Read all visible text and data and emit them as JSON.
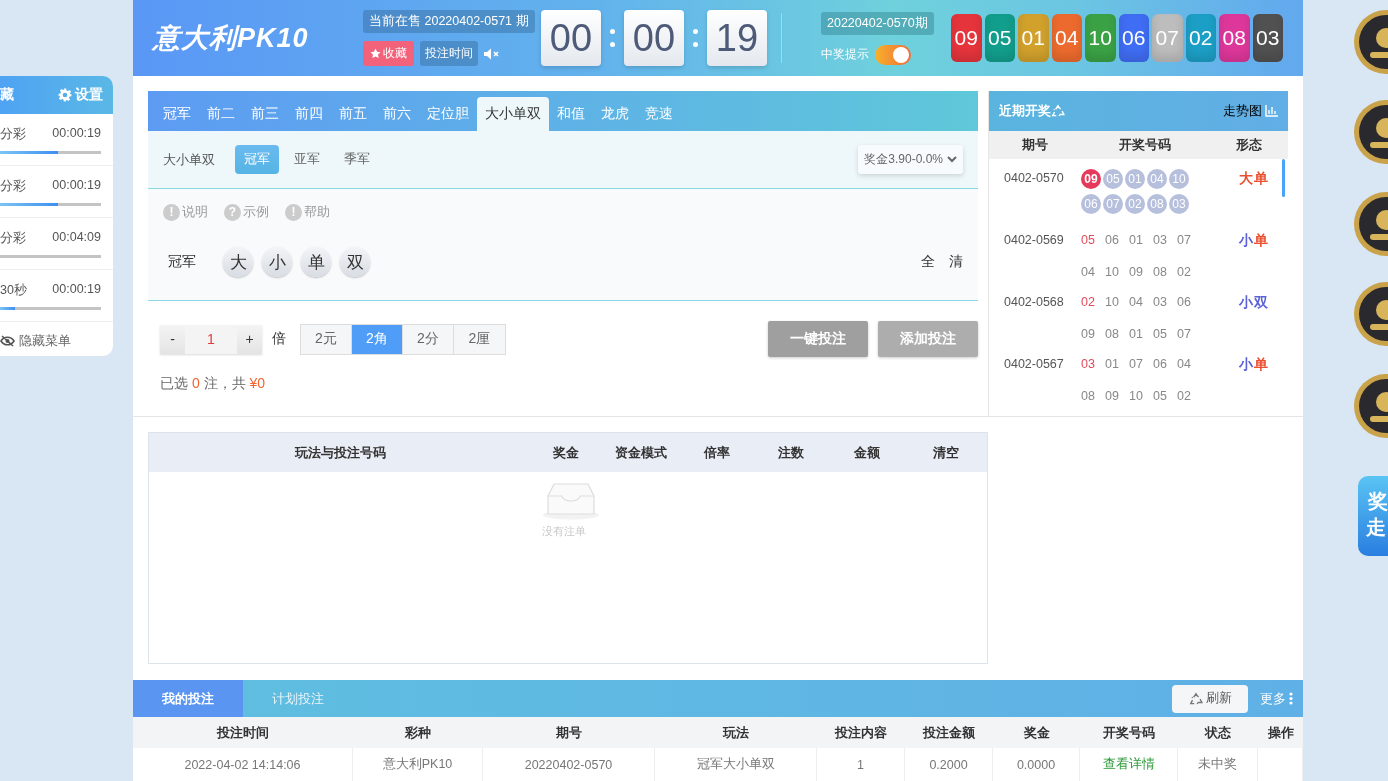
{
  "sidebar": {
    "title": "藏",
    "settings": "设置",
    "items": [
      {
        "name": "分彩",
        "time": "00:00:19",
        "level": 0.57
      },
      {
        "name": "分彩",
        "time": "00:00:19",
        "level": 0.57
      },
      {
        "name": "分彩",
        "time": "00:04:09"
      },
      {
        "name": "30秒",
        "time": "00:00:19",
        "level": 0.15
      }
    ],
    "hide_menu": "隐藏菜单"
  },
  "header": {
    "logo": "意大利PK10",
    "current_issue": "当前在售 20220402-0571 期",
    "favorite": "收藏",
    "bet_time": "投注时间",
    "countdown": [
      "00",
      "00",
      "19"
    ],
    "last_issue": "20220402-0570期",
    "win_alert": {
      "label": "中奖提示",
      "on": true
    },
    "result_numbers": [
      {
        "value": "09",
        "color": "#e5343c"
      },
      {
        "value": "05",
        "color": "#129e8c"
      },
      {
        "value": "01",
        "color": "#d1a12c"
      },
      {
        "value": "04",
        "color": "#ec6a2d"
      },
      {
        "value": "10",
        "color": "#3aa245"
      },
      {
        "value": "06",
        "color": "#3f6df3"
      },
      {
        "value": "07",
        "color": "#bdbdbd"
      },
      {
        "value": "02",
        "color": "#1c9fc6"
      },
      {
        "value": "08",
        "color": "#de379b"
      },
      {
        "value": "03",
        "color": "#515151"
      }
    ]
  },
  "play_tabs": [
    {
      "label": "冠军",
      "selected": false
    },
    {
      "label": "前二",
      "selected": false
    },
    {
      "label": "前三",
      "selected": false
    },
    {
      "label": "前四",
      "selected": false
    },
    {
      "label": "前五",
      "selected": false
    },
    {
      "label": "前六",
      "selected": false
    },
    {
      "label": "定位胆",
      "selected": false
    },
    {
      "label": "大小单双",
      "selected": true
    },
    {
      "label": "和值",
      "selected": false
    },
    {
      "label": "龙虎",
      "selected": false
    },
    {
      "label": "竞速",
      "selected": false
    }
  ],
  "sub_tabs": {
    "label": "大小单双",
    "items": [
      {
        "label": "冠军",
        "selected": true
      },
      {
        "label": "亚军",
        "selected": false
      },
      {
        "label": "季军",
        "selected": false
      }
    ]
  },
  "odds_select": "奖金3.90-0.0%",
  "help_links": [
    {
      "icon": "!",
      "label": "说明"
    },
    {
      "icon": "?",
      "label": "示例"
    },
    {
      "icon": "!",
      "label": "帮助"
    }
  ],
  "bet_row": {
    "label": "冠军",
    "options": [
      {
        "label": "大",
        "selected": false
      },
      {
        "label": "小",
        "selected": false
      },
      {
        "label": "单",
        "selected": false
      },
      {
        "label": "双",
        "selected": false
      }
    ],
    "all": "全",
    "clear": "清"
  },
  "multiplier": {
    "minus": "-",
    "value": "1",
    "plus": "+",
    "unit": "倍"
  },
  "units": [
    {
      "label": "2元",
      "selected": false
    },
    {
      "label": "2角",
      "selected": true
    },
    {
      "label": "2分",
      "selected": false
    },
    {
      "label": "2厘",
      "selected": false
    }
  ],
  "actions": [
    "一键投注",
    "添加投注"
  ],
  "summary": {
    "prefix": "已选",
    "count": "0",
    "middle": "注，共",
    "amount": "¥0"
  },
  "recent": {
    "title": "近期开奖",
    "trend": "走势图",
    "columns": [
      "期号",
      "开奖号码",
      "形态"
    ],
    "rows": [
      {
        "kind": "balls",
        "issue": "0402-0570",
        "numbers": [
          {
            "value": "09",
            "hot": true
          },
          {
            "value": "05",
            "hot": false
          },
          {
            "value": "01",
            "hot": false
          },
          {
            "value": "04",
            "hot": false
          },
          {
            "value": "10",
            "hot": false
          },
          {
            "value": "06",
            "hot": false
          },
          {
            "value": "07",
            "hot": false
          },
          {
            "value": "02",
            "hot": false
          },
          {
            "value": "08",
            "hot": false
          },
          {
            "value": "03",
            "hot": false
          }
        ],
        "pattern": [
          {
            "text": "大",
            "color": "#e8502f"
          },
          {
            "text": "单",
            "color": "#e8502f"
          }
        ]
      },
      {
        "kind": "plain",
        "issue": "0402-0569",
        "numbers": [
          {
            "value": "05",
            "hot": true
          },
          {
            "value": "06",
            "hot": false
          },
          {
            "value": "01",
            "hot": false
          },
          {
            "value": "03",
            "hot": false
          },
          {
            "value": "07",
            "hot": false
          },
          {
            "value": "04",
            "hot": false
          },
          {
            "value": "10",
            "hot": false
          },
          {
            "value": "09",
            "hot": false
          },
          {
            "value": "08",
            "hot": false
          },
          {
            "value": "02",
            "hot": false
          }
        ],
        "pattern": [
          {
            "text": "小",
            "color": "#5b62d6"
          },
          {
            "text": "单",
            "color": "#e8502f"
          }
        ]
      },
      {
        "kind": "plain",
        "issue": "0402-0568",
        "numbers": [
          {
            "value": "02",
            "hot": true
          },
          {
            "value": "10",
            "hot": false
          },
          {
            "value": "04",
            "hot": false
          },
          {
            "value": "03",
            "hot": false
          },
          {
            "value": "06",
            "hot": false
          },
          {
            "value": "09",
            "hot": false
          },
          {
            "value": "08",
            "hot": false
          },
          {
            "value": "01",
            "hot": false
          },
          {
            "value": "05",
            "hot": false
          },
          {
            "value": "07",
            "hot": false
          }
        ],
        "pattern": [
          {
            "text": "小",
            "color": "#5b62d6"
          },
          {
            "text": "双",
            "color": "#5b62d6"
          }
        ]
      },
      {
        "kind": "plain",
        "issue": "0402-0567",
        "numbers": [
          {
            "value": "03",
            "hot": true
          },
          {
            "value": "01",
            "hot": false
          },
          {
            "value": "07",
            "hot": false
          },
          {
            "value": "06",
            "hot": false
          },
          {
            "value": "04",
            "hot": false
          },
          {
            "value": "08",
            "hot": false
          },
          {
            "value": "09",
            "hot": false
          },
          {
            "value": "10",
            "hot": false
          },
          {
            "value": "05",
            "hot": false
          },
          {
            "value": "02",
            "hot": false
          }
        ],
        "pattern": [
          {
            "text": "小",
            "color": "#5b62d6"
          },
          {
            "text": "单",
            "color": "#e8502f"
          }
        ]
      }
    ]
  },
  "bet_list": {
    "columns": [
      "玩法与投注号码",
      "奖金",
      "资金模式",
      "倍率",
      "注数",
      "金额",
      "清空"
    ],
    "empty": "没有注单"
  },
  "orders": {
    "tabs": [
      {
        "label": "我的投注",
        "selected": true
      },
      {
        "label": "计划投注",
        "selected": false
      }
    ],
    "refresh": "刷新",
    "more": "更多",
    "columns": [
      "投注时间",
      "彩种",
      "期号",
      "玩法",
      "投注内容",
      "投注金额",
      "奖金",
      "开奖号码",
      "状态",
      "操作"
    ],
    "rows": [
      {
        "cells": [
          {
            "kind": "text",
            "text": "2022-04-02 14:14:06"
          },
          {
            "kind": "text",
            "text": "意大利PK10"
          },
          {
            "kind": "text",
            "text": "20220402-0570"
          },
          {
            "kind": "text",
            "text": "冠军大小单双"
          },
          {
            "kind": "text",
            "text": "1"
          },
          {
            "kind": "text",
            "text": "0.2000"
          },
          {
            "kind": "text",
            "text": "0.0000"
          },
          {
            "kind": "link",
            "text": "查看详情"
          },
          {
            "kind": "text",
            "text": "未中奖"
          }
        ]
      }
    ]
  },
  "promo": [
    "奖",
    "走"
  ]
}
